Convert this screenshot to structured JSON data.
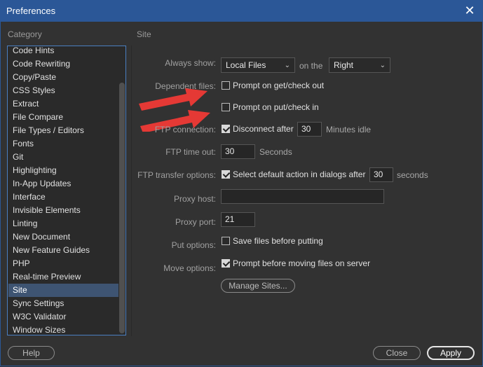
{
  "window": {
    "title": "Preferences",
    "close_glyph": "✕"
  },
  "category_label": "Category",
  "section_title": "Site",
  "categories": [
    "Code Hints",
    "Code Rewriting",
    "Copy/Paste",
    "CSS Styles",
    "Extract",
    "File Compare",
    "File Types / Editors",
    "Fonts",
    "Git",
    "Highlighting",
    "In-App Updates",
    "Interface",
    "Invisible Elements",
    "Linting",
    "New Document",
    "New Feature Guides",
    "PHP",
    "Real-time Preview",
    "Site",
    "Sync Settings",
    "W3C Validator",
    "Window Sizes"
  ],
  "selected_category": "Site",
  "form": {
    "always_show_label": "Always show:",
    "always_show_value": "Local Files",
    "on_the": "on the",
    "side_value": "Right",
    "dependent_files_label": "Dependent files:",
    "prompt_get_label": "Prompt on get/check out",
    "prompt_get_checked": false,
    "prompt_put_label": "Prompt on put/check in",
    "prompt_put_checked": false,
    "ftp_connection_label": "FTP connection:",
    "disconnect_label": "Disconnect after",
    "disconnect_checked": true,
    "disconnect_minutes": "30",
    "minutes_idle": "Minutes idle",
    "ftp_timeout_label": "FTP time out:",
    "ftp_timeout_value": "30",
    "seconds": "Seconds",
    "ftp_transfer_label": "FTP transfer options:",
    "select_default_label": "Select default action in dialogs after",
    "select_default_checked": true,
    "select_default_seconds": "30",
    "seconds_lower": "seconds",
    "proxy_host_label": "Proxy host:",
    "proxy_host_value": "",
    "proxy_port_label": "Proxy port:",
    "proxy_port_value": "21",
    "put_options_label": "Put options:",
    "save_before_put_label": "Save files before putting",
    "save_before_put_checked": false,
    "move_options_label": "Move options:",
    "prompt_move_label": "Prompt before moving files on server",
    "prompt_move_checked": true,
    "manage_sites": "Manage Sites..."
  },
  "footer": {
    "help": "Help",
    "close": "Close",
    "apply": "Apply"
  },
  "colors": {
    "titlebar": "#2b5797",
    "background": "#323232",
    "selected": "#3e5472",
    "arrow": "#e53935"
  }
}
